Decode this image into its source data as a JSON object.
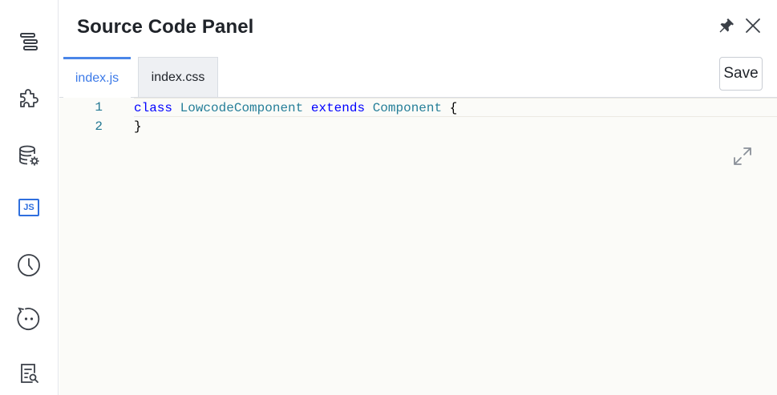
{
  "rail": {
    "items": [
      {
        "icon": "outline-tree-icon"
      },
      {
        "icon": "components-puzzle-icon"
      },
      {
        "icon": "data-source-icon"
      },
      {
        "icon": "js-icon",
        "label": "JS"
      },
      {
        "icon": "history-clock-icon"
      },
      {
        "icon": "assistant-face-icon"
      },
      {
        "icon": "search-document-icon"
      }
    ],
    "accent": "#2f6fde"
  },
  "panel": {
    "title": "Source Code Panel",
    "pin_icon": "pin-icon",
    "close_icon": "close-icon"
  },
  "tabs": [
    {
      "label": "index.js",
      "active": true
    },
    {
      "label": "index.css",
      "active": false
    }
  ],
  "toolbar": {
    "save_label": "Save"
  },
  "editor": {
    "lines": [
      {
        "number": "1",
        "tokens": [
          {
            "text": "class",
            "type": "kw"
          },
          {
            "text": " ",
            "type": "plain"
          },
          {
            "text": "LowcodeComponent",
            "type": "cls"
          },
          {
            "text": " ",
            "type": "plain"
          },
          {
            "text": "extends",
            "type": "kw"
          },
          {
            "text": " ",
            "type": "plain"
          },
          {
            "text": "Component",
            "type": "cls"
          },
          {
            "text": " {",
            "type": "plain"
          }
        ]
      },
      {
        "number": "2",
        "tokens": [
          {
            "text": "}",
            "type": "plain"
          }
        ]
      }
    ],
    "expand_icon": "expand-icon"
  },
  "colors": {
    "tab_active_text": "#3c7ae8",
    "keyword": "#0000ff",
    "class_name": "#267f99",
    "line_number": "#237893"
  }
}
